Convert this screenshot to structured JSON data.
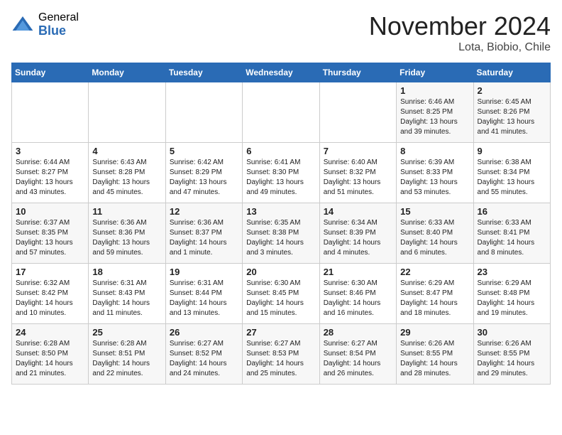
{
  "logo": {
    "general": "General",
    "blue": "Blue"
  },
  "title": "November 2024",
  "location": "Lota, Biobio, Chile",
  "weekdays": [
    "Sunday",
    "Monday",
    "Tuesday",
    "Wednesday",
    "Thursday",
    "Friday",
    "Saturday"
  ],
  "weeks": [
    [
      {
        "day": "",
        "sunrise": "",
        "sunset": "",
        "daylight": ""
      },
      {
        "day": "",
        "sunrise": "",
        "sunset": "",
        "daylight": ""
      },
      {
        "day": "",
        "sunrise": "",
        "sunset": "",
        "daylight": ""
      },
      {
        "day": "",
        "sunrise": "",
        "sunset": "",
        "daylight": ""
      },
      {
        "day": "",
        "sunrise": "",
        "sunset": "",
        "daylight": ""
      },
      {
        "day": "1",
        "sunrise": "Sunrise: 6:46 AM",
        "sunset": "Sunset: 8:25 PM",
        "daylight": "Daylight: 13 hours and 39 minutes."
      },
      {
        "day": "2",
        "sunrise": "Sunrise: 6:45 AM",
        "sunset": "Sunset: 8:26 PM",
        "daylight": "Daylight: 13 hours and 41 minutes."
      }
    ],
    [
      {
        "day": "3",
        "sunrise": "Sunrise: 6:44 AM",
        "sunset": "Sunset: 8:27 PM",
        "daylight": "Daylight: 13 hours and 43 minutes."
      },
      {
        "day": "4",
        "sunrise": "Sunrise: 6:43 AM",
        "sunset": "Sunset: 8:28 PM",
        "daylight": "Daylight: 13 hours and 45 minutes."
      },
      {
        "day": "5",
        "sunrise": "Sunrise: 6:42 AM",
        "sunset": "Sunset: 8:29 PM",
        "daylight": "Daylight: 13 hours and 47 minutes."
      },
      {
        "day": "6",
        "sunrise": "Sunrise: 6:41 AM",
        "sunset": "Sunset: 8:30 PM",
        "daylight": "Daylight: 13 hours and 49 minutes."
      },
      {
        "day": "7",
        "sunrise": "Sunrise: 6:40 AM",
        "sunset": "Sunset: 8:32 PM",
        "daylight": "Daylight: 13 hours and 51 minutes."
      },
      {
        "day": "8",
        "sunrise": "Sunrise: 6:39 AM",
        "sunset": "Sunset: 8:33 PM",
        "daylight": "Daylight: 13 hours and 53 minutes."
      },
      {
        "day": "9",
        "sunrise": "Sunrise: 6:38 AM",
        "sunset": "Sunset: 8:34 PM",
        "daylight": "Daylight: 13 hours and 55 minutes."
      }
    ],
    [
      {
        "day": "10",
        "sunrise": "Sunrise: 6:37 AM",
        "sunset": "Sunset: 8:35 PM",
        "daylight": "Daylight: 13 hours and 57 minutes."
      },
      {
        "day": "11",
        "sunrise": "Sunrise: 6:36 AM",
        "sunset": "Sunset: 8:36 PM",
        "daylight": "Daylight: 13 hours and 59 minutes."
      },
      {
        "day": "12",
        "sunrise": "Sunrise: 6:36 AM",
        "sunset": "Sunset: 8:37 PM",
        "daylight": "Daylight: 14 hours and 1 minute."
      },
      {
        "day": "13",
        "sunrise": "Sunrise: 6:35 AM",
        "sunset": "Sunset: 8:38 PM",
        "daylight": "Daylight: 14 hours and 3 minutes."
      },
      {
        "day": "14",
        "sunrise": "Sunrise: 6:34 AM",
        "sunset": "Sunset: 8:39 PM",
        "daylight": "Daylight: 14 hours and 4 minutes."
      },
      {
        "day": "15",
        "sunrise": "Sunrise: 6:33 AM",
        "sunset": "Sunset: 8:40 PM",
        "daylight": "Daylight: 14 hours and 6 minutes."
      },
      {
        "day": "16",
        "sunrise": "Sunrise: 6:33 AM",
        "sunset": "Sunset: 8:41 PM",
        "daylight": "Daylight: 14 hours and 8 minutes."
      }
    ],
    [
      {
        "day": "17",
        "sunrise": "Sunrise: 6:32 AM",
        "sunset": "Sunset: 8:42 PM",
        "daylight": "Daylight: 14 hours and 10 minutes."
      },
      {
        "day": "18",
        "sunrise": "Sunrise: 6:31 AM",
        "sunset": "Sunset: 8:43 PM",
        "daylight": "Daylight: 14 hours and 11 minutes."
      },
      {
        "day": "19",
        "sunrise": "Sunrise: 6:31 AM",
        "sunset": "Sunset: 8:44 PM",
        "daylight": "Daylight: 14 hours and 13 minutes."
      },
      {
        "day": "20",
        "sunrise": "Sunrise: 6:30 AM",
        "sunset": "Sunset: 8:45 PM",
        "daylight": "Daylight: 14 hours and 15 minutes."
      },
      {
        "day": "21",
        "sunrise": "Sunrise: 6:30 AM",
        "sunset": "Sunset: 8:46 PM",
        "daylight": "Daylight: 14 hours and 16 minutes."
      },
      {
        "day": "22",
        "sunrise": "Sunrise: 6:29 AM",
        "sunset": "Sunset: 8:47 PM",
        "daylight": "Daylight: 14 hours and 18 minutes."
      },
      {
        "day": "23",
        "sunrise": "Sunrise: 6:29 AM",
        "sunset": "Sunset: 8:48 PM",
        "daylight": "Daylight: 14 hours and 19 minutes."
      }
    ],
    [
      {
        "day": "24",
        "sunrise": "Sunrise: 6:28 AM",
        "sunset": "Sunset: 8:50 PM",
        "daylight": "Daylight: 14 hours and 21 minutes."
      },
      {
        "day": "25",
        "sunrise": "Sunrise: 6:28 AM",
        "sunset": "Sunset: 8:51 PM",
        "daylight": "Daylight: 14 hours and 22 minutes."
      },
      {
        "day": "26",
        "sunrise": "Sunrise: 6:27 AM",
        "sunset": "Sunset: 8:52 PM",
        "daylight": "Daylight: 14 hours and 24 minutes."
      },
      {
        "day": "27",
        "sunrise": "Sunrise: 6:27 AM",
        "sunset": "Sunset: 8:53 PM",
        "daylight": "Daylight: 14 hours and 25 minutes."
      },
      {
        "day": "28",
        "sunrise": "Sunrise: 6:27 AM",
        "sunset": "Sunset: 8:54 PM",
        "daylight": "Daylight: 14 hours and 26 minutes."
      },
      {
        "day": "29",
        "sunrise": "Sunrise: 6:26 AM",
        "sunset": "Sunset: 8:55 PM",
        "daylight": "Daylight: 14 hours and 28 minutes."
      },
      {
        "day": "30",
        "sunrise": "Sunrise: 6:26 AM",
        "sunset": "Sunset: 8:55 PM",
        "daylight": "Daylight: 14 hours and 29 minutes."
      }
    ]
  ]
}
